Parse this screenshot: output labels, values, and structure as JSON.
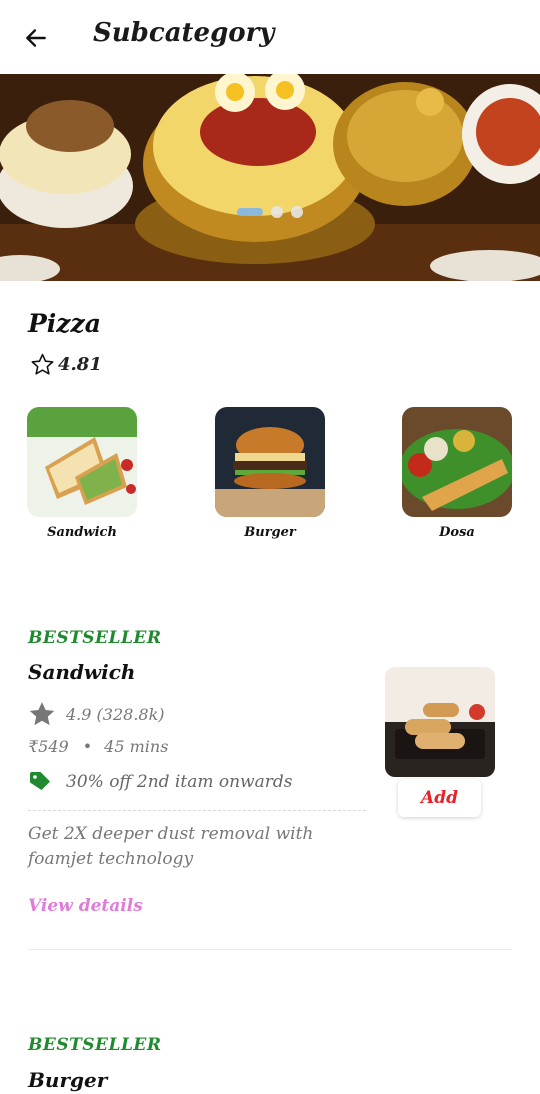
{
  "appbar": {
    "title": "Subcategory",
    "back_icon": "arrow-left-icon"
  },
  "banner": {
    "slides": 3,
    "active_slide": 0,
    "image": "biryani-feast-photo"
  },
  "shop": {
    "name": "Pizza",
    "rating": "4.81",
    "rating_icon": "star-outline-icon"
  },
  "categories": [
    {
      "label": "Sandwich",
      "image": "sandwich-photo"
    },
    {
      "label": "Burger",
      "image": "burger-photo"
    },
    {
      "label": "Dosa",
      "image": "dosa-photo"
    }
  ],
  "items": [
    {
      "badge": "BESTSELLER",
      "name": "Sandwich",
      "rating": "4.9 (328.8k)",
      "price": "₹549",
      "sep": "•",
      "time": "45 mins",
      "offer": "30% off 2nd itam onwards",
      "desc": "Get 2X deeper dust removal with foamjet technology",
      "view_details": "View details",
      "add_label": "Add",
      "image": "spring-rolls-photo"
    },
    {
      "badge": "BESTSELLER",
      "name": "Burger"
    }
  ],
  "colors": {
    "accent_green": "#1f8a2e",
    "add_red": "#e8202a",
    "link_pink": "#e07bd8"
  }
}
